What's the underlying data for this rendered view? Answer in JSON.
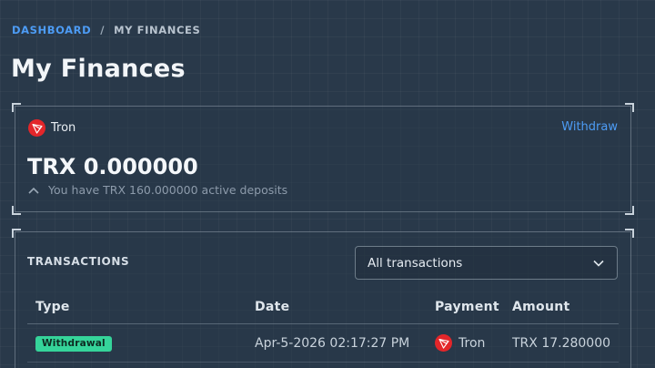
{
  "breadcrumb": {
    "link": "DASHBOARD",
    "separator": "/",
    "current": "MY FINANCES"
  },
  "page": {
    "title": "My Finances"
  },
  "balance_card": {
    "coin_name": "Tron",
    "withdraw_label": "Withdraw",
    "balance": "TRX 0.000000",
    "deposits_text": "You have TRX 160.000000 active deposits"
  },
  "transactions": {
    "heading": "TRANSACTIONS",
    "filter_value": "All transactions",
    "columns": {
      "type": "Type",
      "date": "Date",
      "payment": "Payment",
      "amount": "Amount"
    },
    "rows": [
      {
        "type": "Withdrawal",
        "date": "Apr-5-2026 02:17:27 PM",
        "payment": "Tron",
        "amount": "TRX 17.280000"
      }
    ]
  },
  "colors": {
    "accent": "#4d9cf5",
    "badge": "#35d49a",
    "tron": "#e3262a",
    "background": "#29394a"
  },
  "icons": {
    "coin": "tron-logo-icon",
    "deposits_toggle": "chevron-up-icon",
    "select": "chevron-down-icon"
  }
}
